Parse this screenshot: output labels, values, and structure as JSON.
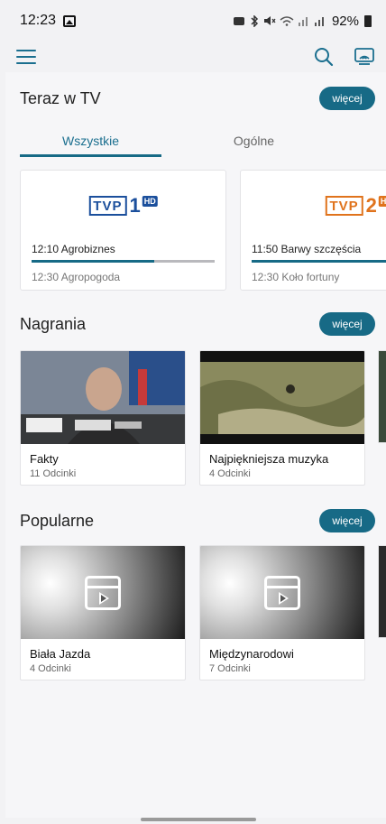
{
  "status_bar": {
    "time": "12:23",
    "battery": "92%"
  },
  "app_bar": {
    "menu_icon": "hamburger-menu-icon",
    "search_icon": "search-icon",
    "cast_icon": "cast-icon"
  },
  "teraz_w_tv": {
    "title": "Teraz w TV",
    "more_label": "więcej",
    "tabs": [
      {
        "label": "Wszystkie",
        "active": true
      },
      {
        "label": "Ogólne",
        "active": false
      }
    ],
    "channels": [
      {
        "logo": {
          "text": "TVP",
          "number": "1",
          "hd": "HD",
          "color": "#1b4f9c"
        },
        "now": "12:10 Agrobiznes",
        "progress": 0.67,
        "next": "12:30 Agropogoda"
      },
      {
        "logo": {
          "text": "TVP",
          "number": "2",
          "hd": "HD",
          "color": "#e0731c"
        },
        "now": "11:50 Barwy szczęścia",
        "progress": 1.0,
        "next": "12:30 Koło fortuny"
      }
    ]
  },
  "nagrania": {
    "title": "Nagrania",
    "more_label": "więcej",
    "items": [
      {
        "title": "Fakty",
        "subtitle": "11 Odcinki"
      },
      {
        "title": "Najpiękniejsza muzyka",
        "subtitle": "4 Odcinki"
      }
    ]
  },
  "popularne": {
    "title": "Popularne",
    "more_label": "więcej",
    "items": [
      {
        "title": "Biała Jazda",
        "subtitle": "4 Odcinki"
      },
      {
        "title": "Międzynarodowi",
        "subtitle": "7 Odcinki"
      }
    ]
  },
  "colors": {
    "accent": "#176a86",
    "background": "#f6f6f8"
  }
}
